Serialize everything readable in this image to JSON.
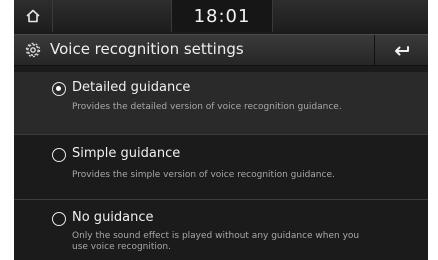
{
  "status_bar": {
    "time": "18:01",
    "home_icon": "home-icon"
  },
  "header": {
    "title": "Voice recognition settings",
    "settings_icon": "gear-icon",
    "back_icon": "back-arrow-icon"
  },
  "options": [
    {
      "label": "Detailed guidance",
      "description": "Provides the detailed version of voice recognition guidance.",
      "selected": true
    },
    {
      "label": "Simple guidance",
      "description": "Provides the simple version of voice recognition guidance.",
      "selected": false
    },
    {
      "label": "No guidance",
      "description_line1": "Only the sound effect is played without any guidance when you",
      "description_line2": "use voice recognition.",
      "selected": false
    }
  ]
}
